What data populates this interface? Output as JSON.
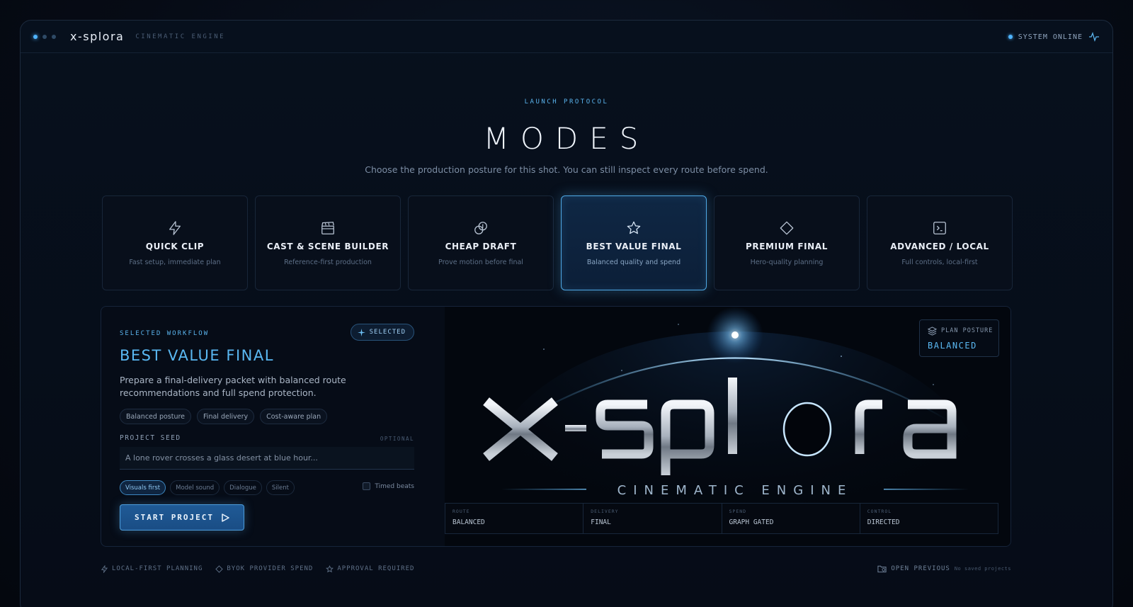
{
  "app": {
    "name": "x-splora",
    "subtitle": "CINEMATIC ENGINE",
    "status": "SYSTEM ONLINE"
  },
  "header": {
    "eyebrow": "LAUNCH PROTOCOL",
    "title": "MODES",
    "subtitle": "Choose the production posture for this shot. You can still inspect every route before spend."
  },
  "modes": [
    {
      "title": "QUICK CLIP",
      "desc": "Fast setup, immediate plan",
      "icon": "lightning-icon"
    },
    {
      "title": "CAST & SCENE BUILDER",
      "desc": "Reference-first production",
      "icon": "clapperboard-icon"
    },
    {
      "title": "CHEAP DRAFT",
      "desc": "Prove motion before final",
      "icon": "coins-icon"
    },
    {
      "title": "BEST VALUE FINAL",
      "desc": "Balanced quality and spend",
      "icon": "star-icon",
      "active": true
    },
    {
      "title": "PREMIUM FINAL",
      "desc": "Hero-quality planning",
      "icon": "diamond-icon"
    },
    {
      "title": "ADVANCED / LOCAL",
      "desc": "Full controls, local-first",
      "icon": "terminal-icon"
    }
  ],
  "workflow": {
    "label": "SELECTED WORKFLOW",
    "badge": "SELECTED",
    "title": "BEST VALUE FINAL",
    "desc": "Prepare a final-delivery packet with balanced route recommendations and full spend protection.",
    "chips": [
      "Balanced posture",
      "Final delivery",
      "Cost-aware plan"
    ],
    "seed_label": "PROJECT SEED",
    "seed_optional": "OPTIONAL",
    "seed_placeholder": "A lone rover crosses a glass desert at blue hour...",
    "options": [
      "Visuals first",
      "Model sound",
      "Dialogue",
      "Silent"
    ],
    "timed_beats": "Timed beats",
    "start": "START PROJECT"
  },
  "hero": {
    "logo": "x-splora",
    "tagline": "CINEMATIC ENGINE",
    "posture_label": "PLAN POSTURE",
    "posture_value": "BALANCED",
    "stats": [
      {
        "k": "ROUTE",
        "v": "BALANCED"
      },
      {
        "k": "DELIVERY",
        "v": "FINAL"
      },
      {
        "k": "SPEND",
        "v": "GRAPH GATED"
      },
      {
        "k": "CONTROL",
        "v": "DIRECTED"
      }
    ]
  },
  "footer": {
    "items": [
      "LOCAL-FIRST PLANNING",
      "BYOK PROVIDER SPEND",
      "APPROVAL REQUIRED"
    ],
    "open_previous": "OPEN PREVIOUS",
    "no_saved": "No saved projects"
  },
  "colors": {
    "accent": "#5ab8f2",
    "bg": "#060c17",
    "border": "#16243a"
  }
}
